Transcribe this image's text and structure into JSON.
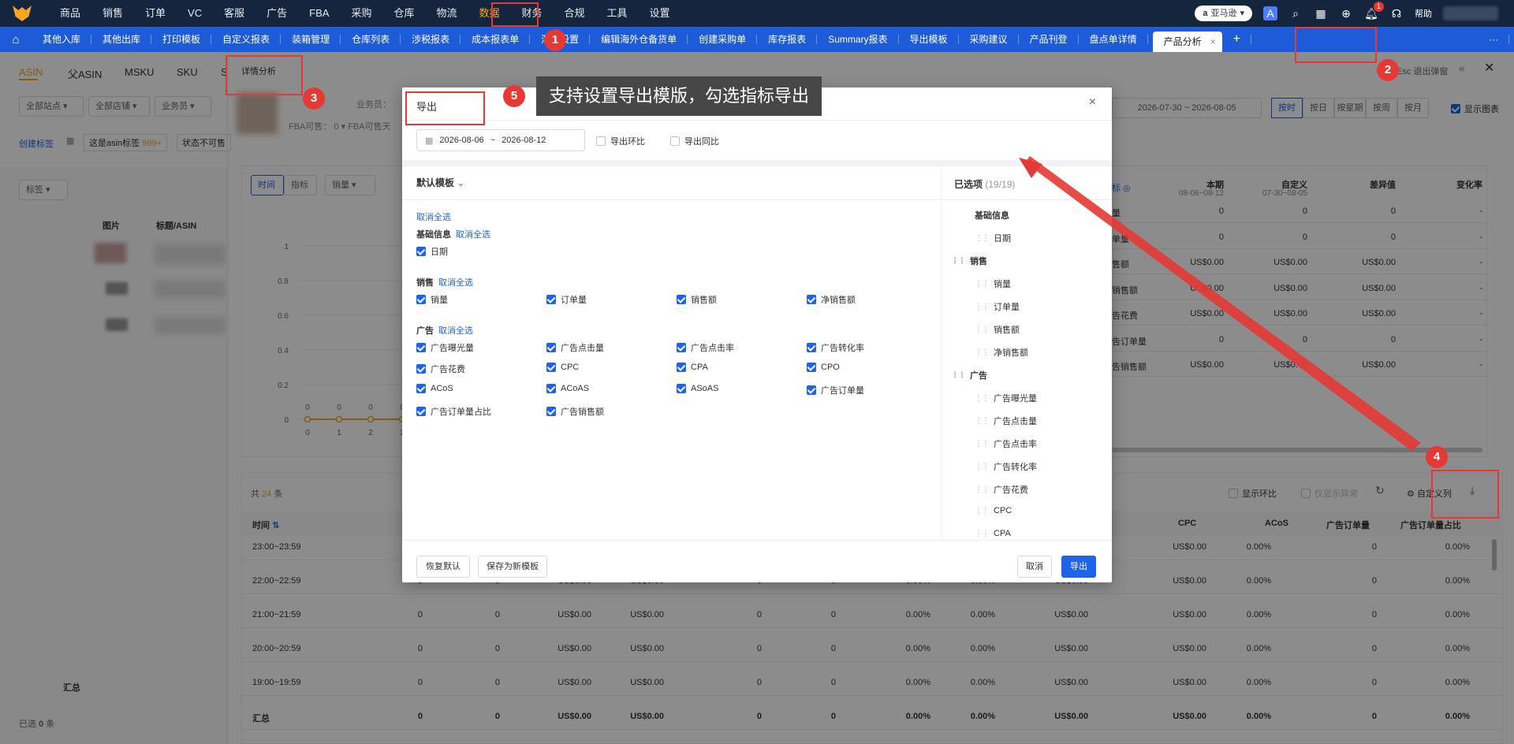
{
  "topnav": {
    "items": [
      "商品",
      "销售",
      "订单",
      "VC",
      "客服",
      "广告",
      "FBA",
      "采购",
      "仓库",
      "物流",
      "数据",
      "财务",
      "合规",
      "工具",
      "设置"
    ],
    "active_index": 10,
    "marketplace": "亚马逊",
    "notification_count": "1",
    "help": "帮助"
  },
  "tabs": {
    "items": [
      "其他入库",
      "其他出库",
      "打印模板",
      "自定义报表",
      "装箱管理",
      "仓库列表",
      "涉税报表",
      "成本报表单",
      "汇率设置",
      "编辑海外仓备货单",
      "创建采购单",
      "库存报表",
      "Summary报表",
      "导出模板",
      "采购建议",
      "产品刊登",
      "盘点单详情"
    ],
    "active": "产品分析",
    "plus": "+",
    "more": "···"
  },
  "page": {
    "subtabs": [
      "ASIN",
      "父ASIN",
      "MSKU",
      "SKU",
      "S"
    ],
    "detail_tab": "详情分析",
    "filters": [
      "全部站点",
      "全部店铺",
      "业务员"
    ],
    "salesperson_label": "业务员：",
    "fba_label": "FBA可售：",
    "fba_value": "0",
    "fba_label2": "FBA可售天",
    "create_tag": "创建标签",
    "asin_tag": "这是asin标签",
    "asin_tag_count": "999+",
    "status_tag": "状态不可售",
    "tag_select": "标签",
    "table_headers": [
      "图片",
      "标题/ASIN"
    ],
    "total_label": "汇总",
    "selected_prefix": "已选",
    "selected_count": "0",
    "selected_suffix": "条",
    "esc_hint": "Esc 退出弹窗",
    "date_range": "2026-07-30 ~ 2026-08-05",
    "period_buttons": [
      "按时",
      "按日",
      "按星期",
      "按周",
      "按月"
    ],
    "show_chart": "显示图表",
    "chart_view_tabs": [
      "时间",
      "指标"
    ],
    "chart_metric": "销量",
    "y_ticks": [
      "1",
      "0.8",
      "0.6",
      "0.4",
      "0.2",
      "0"
    ],
    "x_ticks": [
      "0",
      "1",
      "2",
      "3"
    ],
    "point_labels": [
      "0",
      "0",
      "0",
      "0"
    ],
    "right_table_headers": [
      "本期",
      "自定义",
      "差异值",
      "变化率"
    ],
    "right_table_subheaders": [
      "08-06~08-12",
      "07-30~08-05"
    ],
    "right_table_rows": [
      [
        "量",
        "0",
        "0",
        "0",
        "-"
      ],
      [
        "单量",
        "0",
        "0",
        "0",
        "-"
      ],
      [
        "售额",
        "US$0.00",
        "US$0.00",
        "US$0.00",
        "-"
      ],
      [
        "销售额",
        "US$0.00",
        "US$0.00",
        "US$0.00",
        "-"
      ],
      [
        "告花费",
        "US$0.00",
        "US$0.00",
        "US$0.00",
        "-"
      ],
      [
        "告订单量",
        "0",
        "0",
        "0",
        "-"
      ],
      [
        "告销售额",
        "US$0.00",
        "US$0.00",
        "US$0.00",
        "-"
      ]
    ],
    "total_count_prefix": "共",
    "total_count": "24",
    "total_count_suffix": "条",
    "toolbar": [
      "显示环比",
      "仅显示异常",
      "自定义列"
    ],
    "bottom_headers": [
      "时间",
      "CPC",
      "ACoS",
      "广告订单量",
      "广告订单量占比"
    ],
    "bottom_rows": [
      {
        "time": "23:00~23:59",
        "cells": [
          "0",
          "0",
          "US$0.00",
          "US$0.00",
          "0",
          "0",
          "0.00%",
          "0.00%",
          "US$0.00",
          "US$0.00",
          "0.00%",
          "0",
          "0.00%"
        ]
      },
      {
        "time": "22:00~22:59",
        "cells": [
          "0",
          "0",
          "US$0.00",
          "US$0.00",
          "0",
          "0",
          "0.00%",
          "0.00%",
          "US$0.00",
          "US$0.00",
          "0.00%",
          "0",
          "0.00%"
        ]
      },
      {
        "time": "21:00~21:59",
        "cells": [
          "0",
          "0",
          "US$0.00",
          "US$0.00",
          "0",
          "0",
          "0.00%",
          "0.00%",
          "US$0.00",
          "US$0.00",
          "0.00%",
          "0",
          "0.00%"
        ]
      },
      {
        "time": "20:00~20:59",
        "cells": [
          "0",
          "0",
          "US$0.00",
          "US$0.00",
          "0",
          "0",
          "0.00%",
          "0.00%",
          "US$0.00",
          "US$0.00",
          "0.00%",
          "0",
          "0.00%"
        ]
      },
      {
        "time": "19:00~19:59",
        "cells": [
          "0",
          "0",
          "US$0.00",
          "US$0.00",
          "0",
          "0",
          "0.00%",
          "0.00%",
          "US$0.00",
          "US$0.00",
          "0.00%",
          "0",
          "0.00%"
        ]
      },
      {
        "time": "汇总",
        "cells": [
          "0",
          "0",
          "US$0.00",
          "US$0.00",
          "0",
          "0",
          "0.00%",
          "0.00%",
          "US$0.00",
          "US$0.00",
          "0.00%",
          "0",
          "0.00%"
        ]
      }
    ]
  },
  "modal": {
    "title": "导出",
    "date_start": "2026-08-06",
    "date_sep": "~",
    "date_end": "2026-08-12",
    "export_mom": "导出环比",
    "export_yoy": "导出同比",
    "template": "默认模板",
    "deselect_all": "取消全选",
    "groups": [
      {
        "name": "基础信息",
        "link": "取消全选",
        "items": [
          "日期"
        ]
      },
      {
        "name": "销售",
        "link": "取消全选",
        "items": [
          "销量",
          "订单量",
          "销售额",
          "净销售额"
        ]
      },
      {
        "name": "广告",
        "link": "取消全选",
        "items": [
          "广告曝光量",
          "广告点击量",
          "广告点击率",
          "广告转化率",
          "广告花费",
          "CPC",
          "CPA",
          "CPO",
          "ACoS",
          "ACoAS",
          "ASoAS",
          "广告订单量",
          "广告订单量占比",
          "广告销售额"
        ]
      }
    ],
    "selected_title": "已选项",
    "selected_count": "(19/19)",
    "selected_list": [
      {
        "type": "group",
        "text": "基础信息"
      },
      {
        "type": "item",
        "text": "日期"
      },
      {
        "type": "group",
        "text": "销售"
      },
      {
        "type": "item",
        "text": "销量"
      },
      {
        "type": "item",
        "text": "订单量"
      },
      {
        "type": "item",
        "text": "销售额"
      },
      {
        "type": "item",
        "text": "净销售额"
      },
      {
        "type": "group",
        "text": "广告"
      },
      {
        "type": "item",
        "text": "广告曝光量"
      },
      {
        "type": "item",
        "text": "广告点击量"
      },
      {
        "type": "item",
        "text": "广告点击率"
      },
      {
        "type": "item",
        "text": "广告转化率"
      },
      {
        "type": "item",
        "text": "广告花费"
      },
      {
        "type": "item",
        "text": "CPC"
      },
      {
        "type": "item",
        "text": "CPA"
      }
    ],
    "restore": "恢复默认",
    "save_new": "保存为新模板",
    "cancel": "取消",
    "export": "导出"
  },
  "annotations": {
    "steps": [
      "1",
      "2",
      "3",
      "4",
      "5"
    ],
    "tooltip": "支持设置导出模版，勾选指标导出",
    "color": "#e53935"
  }
}
